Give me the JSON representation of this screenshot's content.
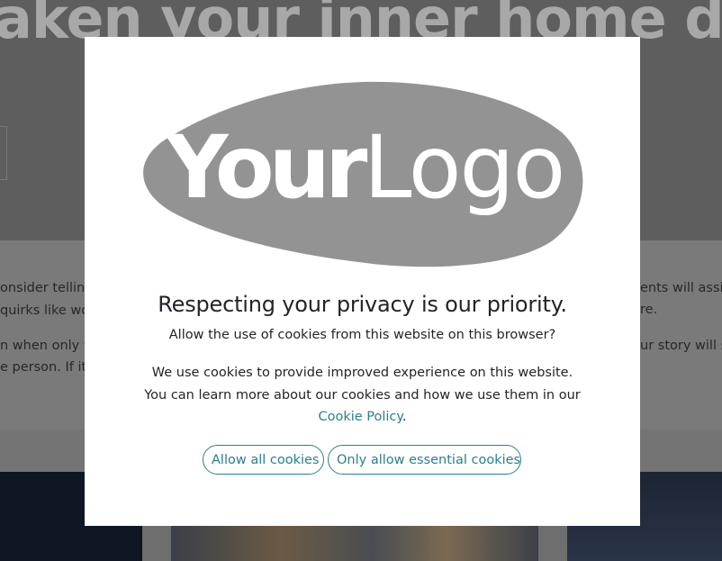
{
  "background": {
    "hero_title": "aken your inner home design",
    "left_lines": [
      "onsider telling",
      "quirks like wo",
      "n when only w",
      "e person. If it's"
    ],
    "right_lines": [
      "ents will assist",
      "re.",
      "ur story will so"
    ]
  },
  "logo": {
    "text_bold": "Your",
    "text_light": "Logo",
    "shape_color": "#939393"
  },
  "modal": {
    "title": "Respecting your privacy is our priority.",
    "question": "Allow the use of cookies from this website on this browser?",
    "body_text": "We use cookies to provide improved experience on this website. You can learn more about our cookies and how we use them in our ",
    "policy_link": "Cookie Policy",
    "body_end": ".",
    "allow_all_label": "Allow all cookies",
    "essential_label": "Only allow essential cookies",
    "accent_color": "#2b7f8d"
  }
}
